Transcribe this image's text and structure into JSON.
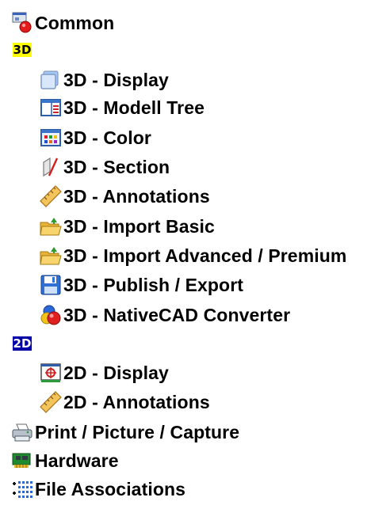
{
  "tree": {
    "common": "Common",
    "group_3d": {
      "badge": "3D"
    },
    "items_3d": [
      {
        "label": "3D - Display",
        "icon": "display-cube-icon"
      },
      {
        "label": "3D - Modell Tree",
        "icon": "model-tree-icon"
      },
      {
        "label": "3D - Color",
        "icon": "color-palette-icon"
      },
      {
        "label": "3D - Section",
        "icon": "section-plane-icon"
      },
      {
        "label": "3D - Annotations",
        "icon": "ruler-icon"
      },
      {
        "label": "3D - Import Basic",
        "icon": "folder-open-icon"
      },
      {
        "label": "3D - Import Advanced / Premium",
        "icon": "folder-open-icon"
      },
      {
        "label": "3D - Publish / Export",
        "icon": "floppy-disk-icon"
      },
      {
        "label": "3D - NativeCAD Converter",
        "icon": "converter-icon"
      }
    ],
    "group_2d": {
      "badge": "2D"
    },
    "items_2d": [
      {
        "label": "2D - Display",
        "icon": "crosshair-display-icon"
      },
      {
        "label": "2D - Annotations",
        "icon": "ruler-icon"
      }
    ],
    "print": "Print / Picture / Capture",
    "hardware": "Hardware",
    "file_assoc": "File Associations"
  }
}
